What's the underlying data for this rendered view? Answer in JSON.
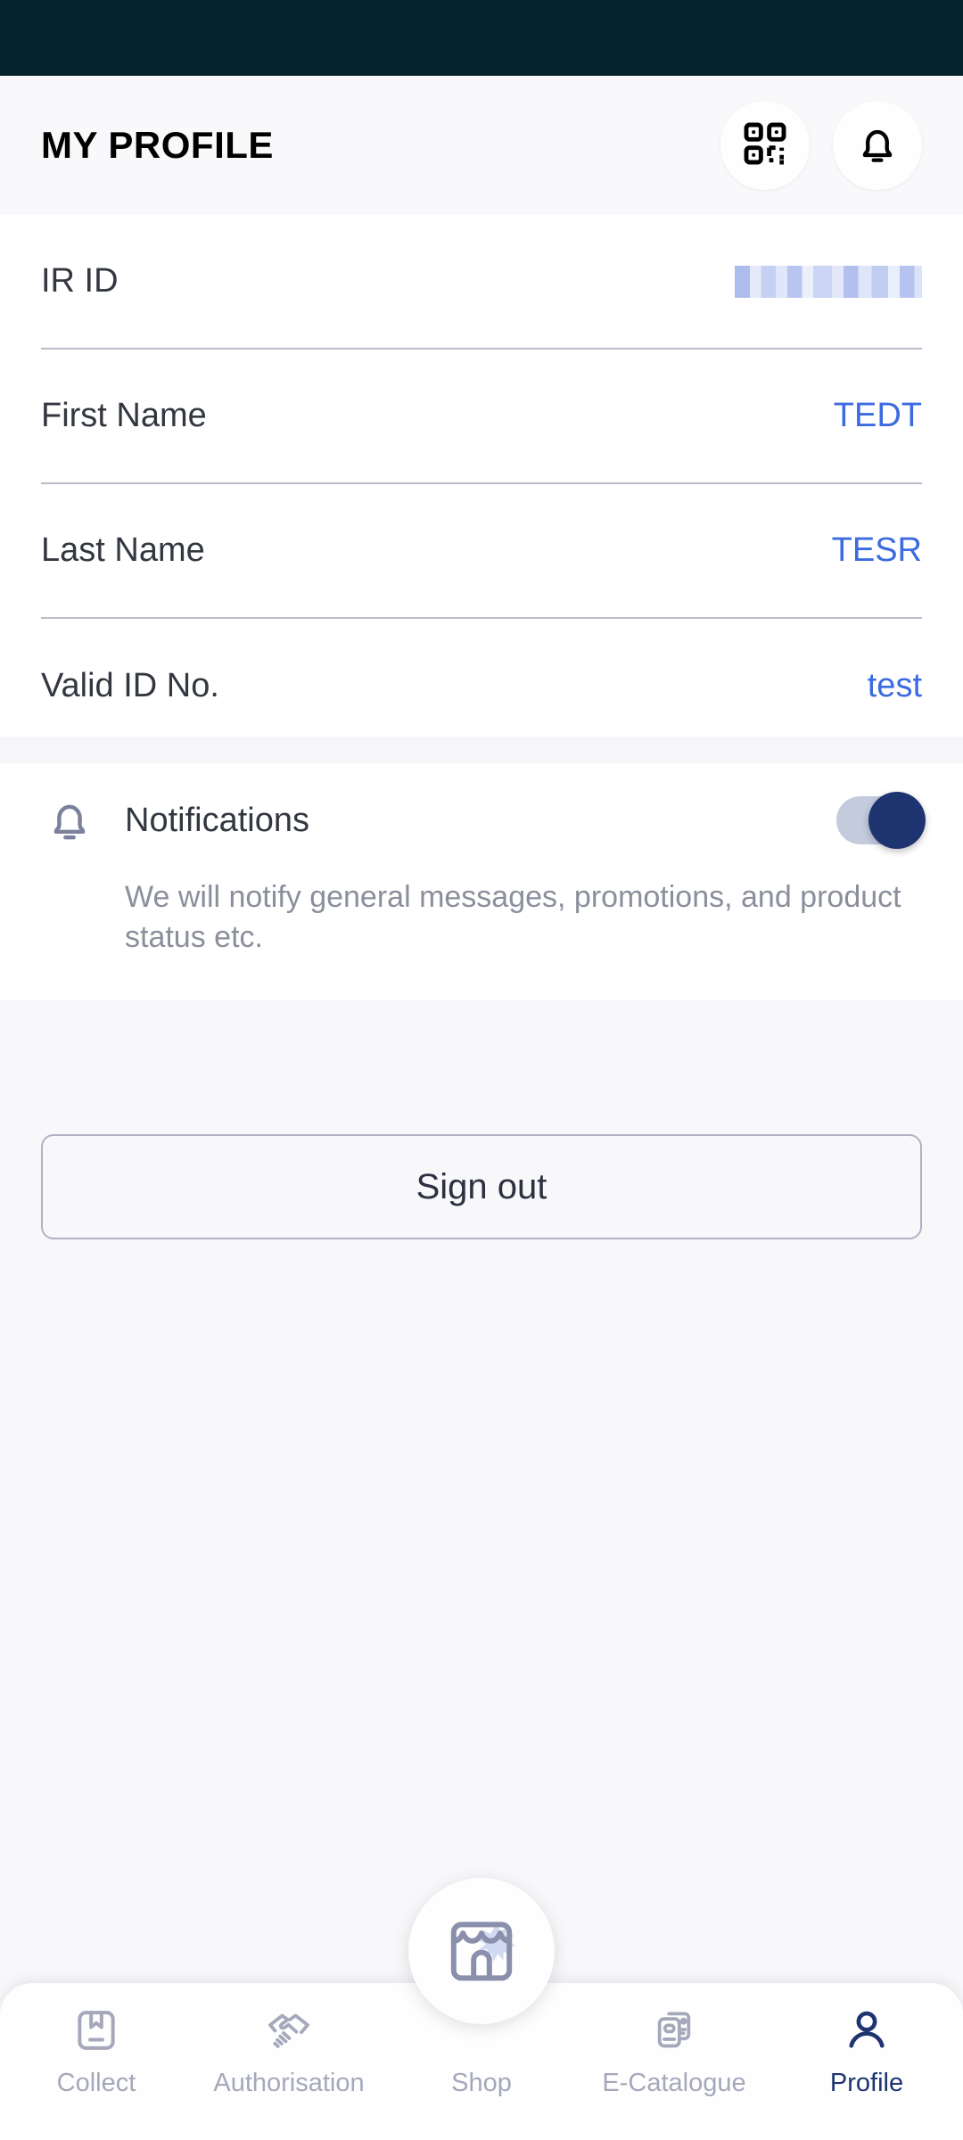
{
  "statusbar": {
    "color": "#04232f"
  },
  "header": {
    "title": "MY PROFILE",
    "qr_icon": "qr-code-icon",
    "bell_icon": "bell-icon"
  },
  "profile": {
    "fields": [
      {
        "label": "IR ID",
        "value": "",
        "redacted": true
      },
      {
        "label": "First Name",
        "value": "TEDT",
        "redacted": false
      },
      {
        "label": "Last Name",
        "value": "TESR",
        "redacted": false
      },
      {
        "label": "Valid ID No.",
        "value": "test",
        "redacted": false
      }
    ],
    "value_color": "#3c6ae1"
  },
  "notifications": {
    "icon": "bell-icon",
    "title": "Notifications",
    "description": "We will notify general messages, promotions, and product status etc.",
    "toggle_on": true,
    "toggle_on_color": "#1d3470",
    "toggle_track_color": "#c3cbdd"
  },
  "actions": {
    "sign_out_label": "Sign out"
  },
  "bottom_nav": {
    "active_color": "#1d3470",
    "inactive_color": "#a5a8ba",
    "items": [
      {
        "label": "Collect",
        "icon": "package-bookmark-icon",
        "active": false
      },
      {
        "label": "Authorisation",
        "icon": "handshake-icon",
        "active": false
      },
      {
        "label": "Shop",
        "icon": "storefront-icon",
        "active": false
      },
      {
        "label": "E-Catalogue",
        "icon": "catalogue-cards-icon",
        "active": false
      },
      {
        "label": "Profile",
        "icon": "person-icon",
        "active": true
      }
    ]
  }
}
